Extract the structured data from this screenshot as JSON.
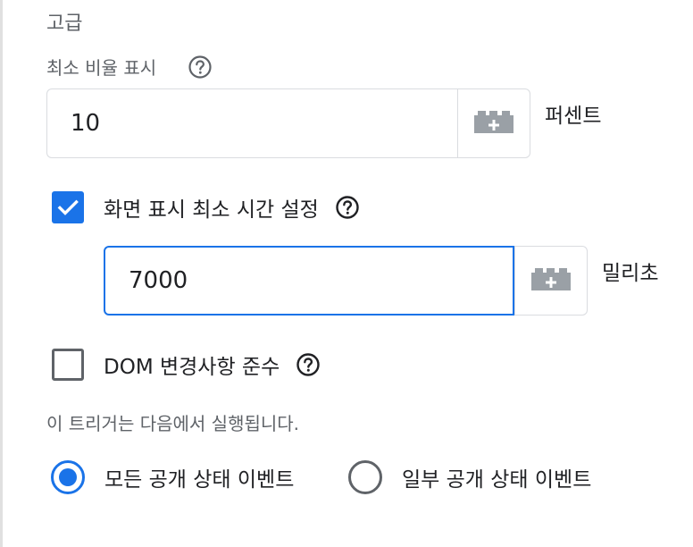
{
  "section": {
    "title": "고급"
  },
  "min_ratio": {
    "label": "최소 비율 표시",
    "value": "10",
    "unit": "퍼센트",
    "help_icon": "help-circle-icon",
    "variable_icon": "variable-brick-plus-icon"
  },
  "min_time": {
    "checkbox_label": "화면 표시 최소 시간 설정",
    "checked": true,
    "value": "7000",
    "unit": "밀리초",
    "help_icon": "help-circle-icon",
    "variable_icon": "variable-brick-plus-icon"
  },
  "dom_changes": {
    "checkbox_label": "DOM 변경사항 준수",
    "checked": false,
    "help_icon": "help-circle-icon"
  },
  "fire_on": {
    "hint": "이 트리거는 다음에서 실행됩니다.",
    "options": [
      {
        "label": "모든 공개 상태 이벤트",
        "selected": true
      },
      {
        "label": "일부 공개 상태 이벤트",
        "selected": false
      }
    ]
  },
  "colors": {
    "accent": "#1a73e8",
    "border": "#dadce0",
    "muted_text": "#5f6368",
    "text": "#202124",
    "icon_gray": "#9aa0a6"
  }
}
